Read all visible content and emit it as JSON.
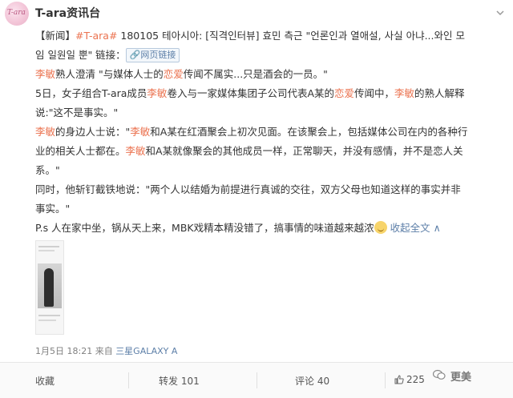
{
  "account": {
    "name": "T-ara资讯台",
    "avatar_text": "T-ara"
  },
  "post": {
    "line1_a": "【新闻】",
    "line1_tag": "#T-ara#",
    "line1_b": " 180105 테아시아: [직격인터뷰] 효민 측근 \"언론인과 열애설, 사실 아냐...와인 모",
    "line2_a": "임 일원일 뿐\" 链接：",
    "weblink_label": "网页链接",
    "p1_name": "李敏",
    "p1_a": "熟人澄清 \"与媒体人士的",
    "p1_love": "恋爱",
    "p1_b": "传闻不属实...只是酒会的一员。\"",
    "p2_a": "5日，女子组合T-ara成员",
    "p2_name": "李敏",
    "p2_b": "卷入与一家媒体集团子公司代表A某的",
    "p2_love": "恋爱",
    "p2_c": "传闻中，",
    "p2_name2": "李敏",
    "p2_d": "的熟人解释",
    "p2_e": "说:\"这不是事实。\"",
    "p3_name": "李敏",
    "p3_a": "的身边人士说：\"",
    "p3_name2": "李敏",
    "p3_b": "和A某在红酒聚会上初次见面。在该聚会上，包括媒体公司在内的各种行",
    "p3_c": "业的相关人士都在。",
    "p3_name3": "李敏",
    "p3_d": "和A某就像聚会的其他成员一样，正常聊天，并没有感情，并不是恋人关",
    "p3_e": "系。\"",
    "p4_a": "同时，他斩钉截铁地说：\"两个人以结婚为前提进行真诚的交往，双方父母也知道这样的事实并非",
    "p4_b": "事实。\"",
    "p5_a": "P.s 人在家中坐，锅从天上来，MBK戏精本精没错了，搞事情的味道越来越浓",
    "collapse": "收起全文",
    "collapse_arrow": "∧",
    "time": "1月5日 18:21 来自 ",
    "source": "三星GALAXY A"
  },
  "actions": {
    "favorite": "收藏",
    "repost": "转发 101",
    "comment": "评论 40",
    "like": "225"
  },
  "watermark": "更美",
  "colors": {
    "link": "#eb7350",
    "blue": "#5d7fa8",
    "text": "#333333"
  }
}
